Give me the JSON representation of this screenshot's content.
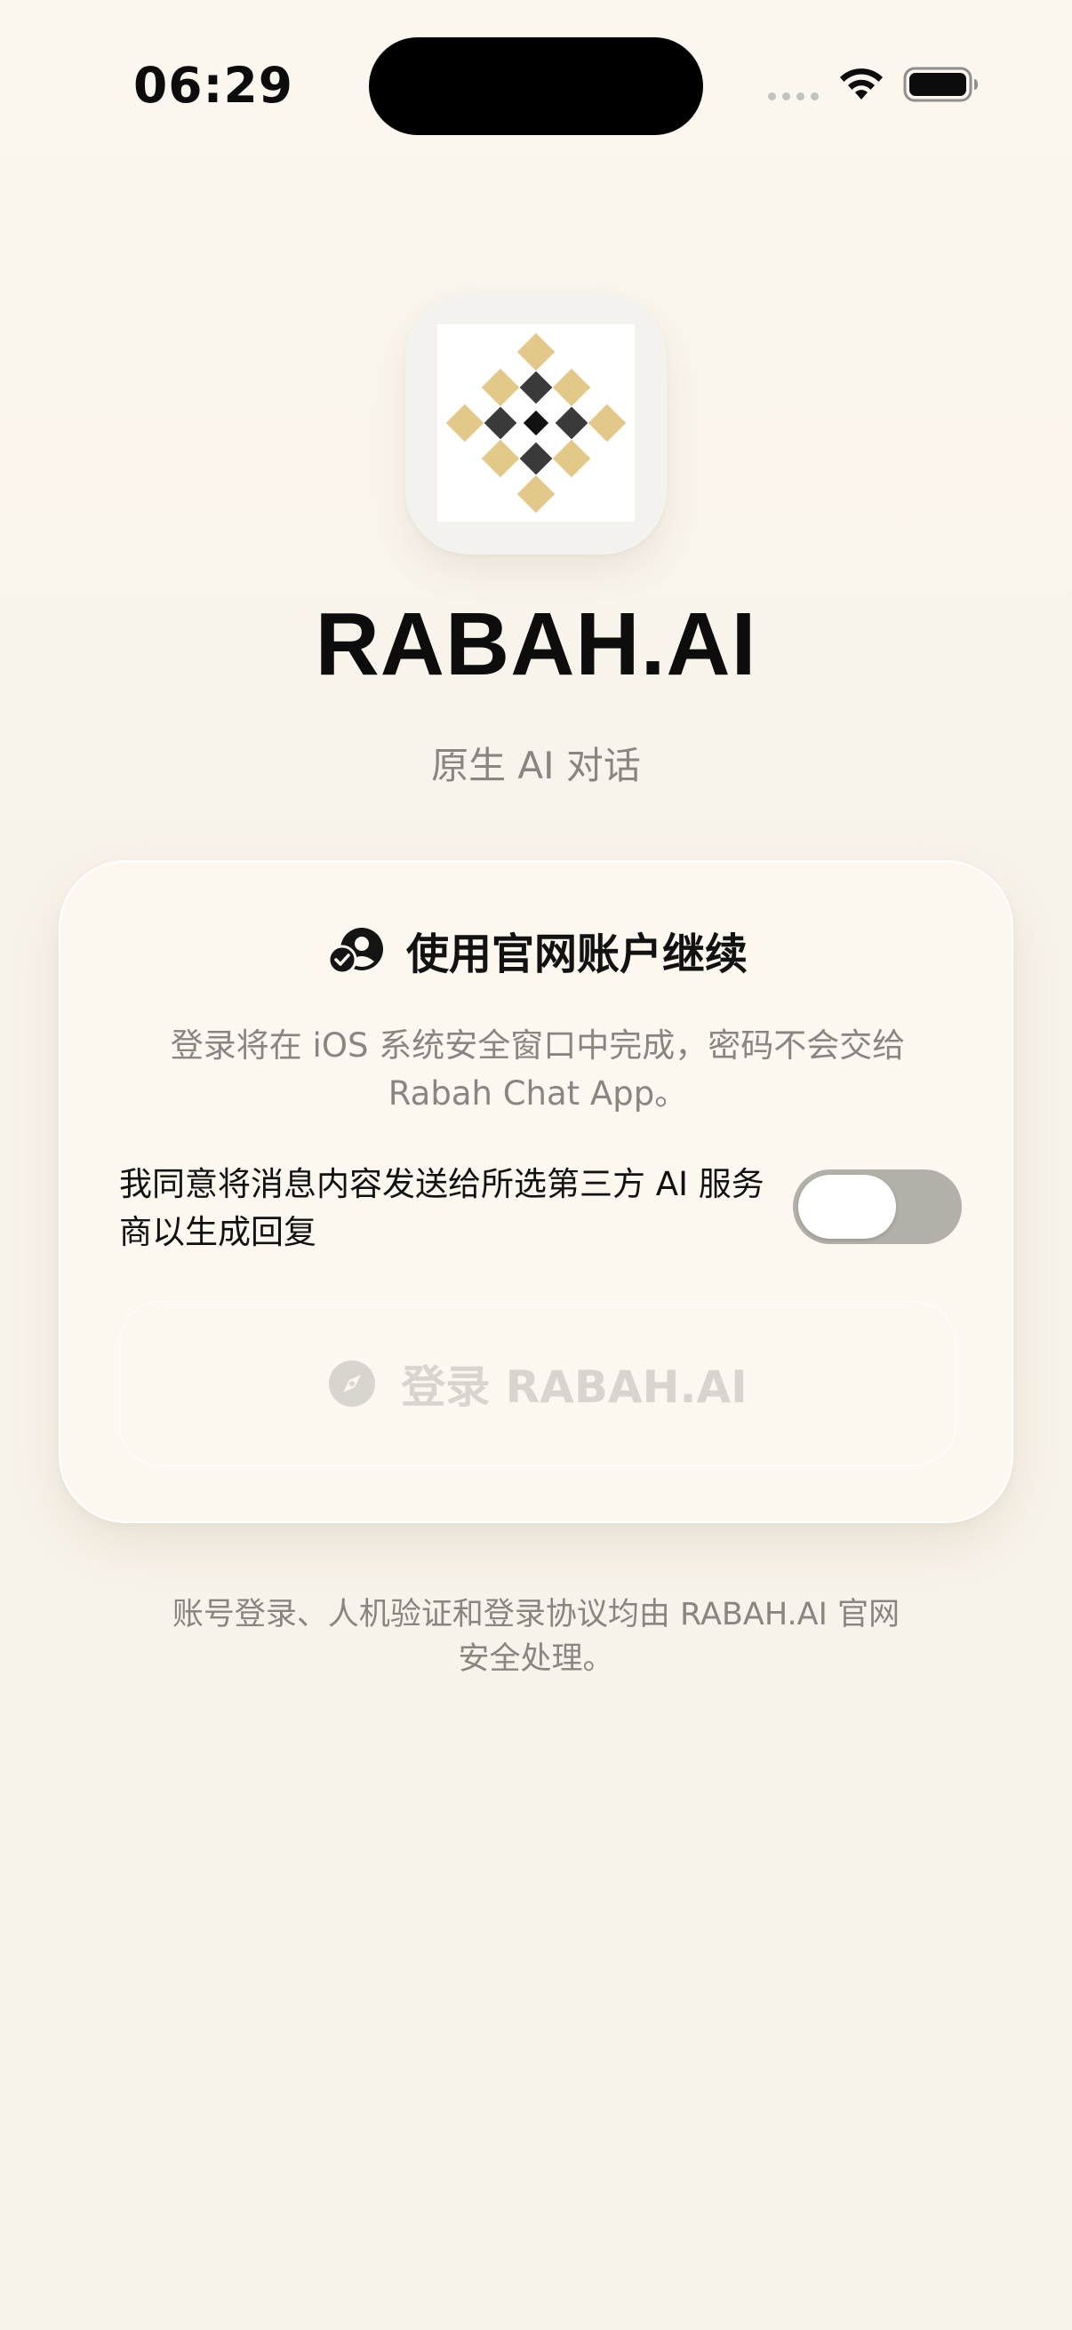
{
  "status_bar": {
    "time": "06:29",
    "icons": [
      "signal-dots-icon",
      "wifi-icon",
      "battery-icon"
    ]
  },
  "app": {
    "icon": "rabah-logo-icon",
    "title": "RABAH.AI",
    "subtitle": "原生 AI 对话"
  },
  "card": {
    "header_icon": "account-icon",
    "title": "使用官网账户继续",
    "description": "登录将在 iOS 系统安全窗口中完成，密码不会交给 Rabah Chat App。",
    "consent": {
      "label": "我同意将消息内容发送给所选第三方 AI 服务商以生成回复",
      "toggle_on": false
    },
    "login_button": {
      "icon": "compass-icon",
      "label": "登录 RABAH.AI",
      "enabled": false
    }
  },
  "footer": {
    "note": "账号登录、人机验证和登录协议均由 RABAH.AI 官网安全处理。"
  },
  "colors": {
    "background": "#f8f3ea",
    "card": "#fcf8f0",
    "gold": "#e3c989",
    "dark": "#3a3a3a",
    "toggle_off": "#b3afa9",
    "muted_text": "#8a857f"
  }
}
